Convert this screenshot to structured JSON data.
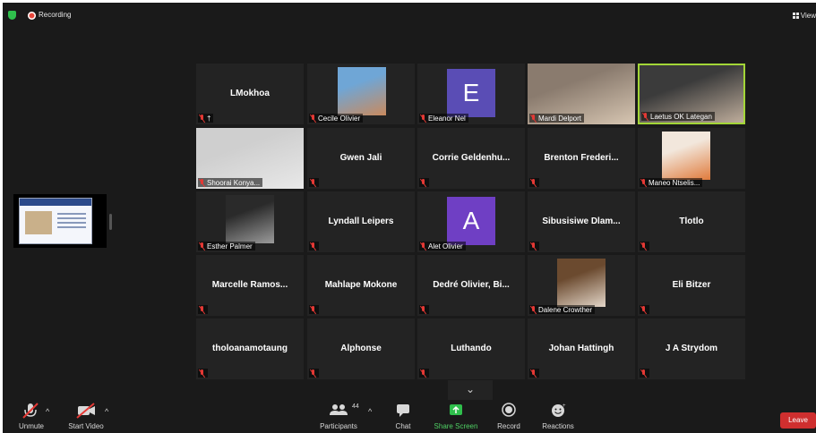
{
  "topbar": {
    "recording_label": "Recording",
    "view_label": "View"
  },
  "participants": [
    {
      "name": "LMokhoa",
      "display": "name",
      "caption": ""
    },
    {
      "name": "Cecile Olivier",
      "display": "photo",
      "caption": "Cecile Olivier"
    },
    {
      "name": "Eleanor Nel",
      "display": "letter",
      "letter": "E",
      "avatar_color": "#5a4db5",
      "caption": "Eleanor Nel"
    },
    {
      "name": "Mardi Delport",
      "display": "photo",
      "caption": "Mardi Delport"
    },
    {
      "name": "Laetus OK Lategan",
      "display": "photo",
      "caption": "Laetus OK Lategan",
      "active": true
    },
    {
      "name": "Shoorai Konya...",
      "display": "photo",
      "caption": "Shoorai Konya..."
    },
    {
      "name": "Gwen Jali",
      "display": "name",
      "caption": ""
    },
    {
      "name": "Corrie  Geldenhu...",
      "display": "name",
      "caption": ""
    },
    {
      "name": "Brenton  Frederi...",
      "display": "name",
      "caption": ""
    },
    {
      "name": "Maneo Ntselis...",
      "display": "photo",
      "caption": "Maneo Ntselis..."
    },
    {
      "name": "Esther Palmer",
      "display": "photo",
      "caption": "Esther Palmer"
    },
    {
      "name": "Lyndall Leipers",
      "display": "name",
      "caption": ""
    },
    {
      "name": "Alet Olivier",
      "display": "letter",
      "letter": "A",
      "avatar_color": "#6f3fc4",
      "caption": "Alet Olivier"
    },
    {
      "name": "Sibusisiwe  Dlam...",
      "display": "name",
      "caption": ""
    },
    {
      "name": "Tlotlo",
      "display": "name",
      "caption": ""
    },
    {
      "name": "Marcelle  Ramos...",
      "display": "name",
      "caption": ""
    },
    {
      "name": "Mahlape Mokone",
      "display": "name",
      "caption": ""
    },
    {
      "name": "Dedré  Olivier,  Bi...",
      "display": "name",
      "caption": ""
    },
    {
      "name": "Dalene Crowther",
      "display": "photo",
      "caption": "Dalene Crowther"
    },
    {
      "name": "Eli Bitzer",
      "display": "name",
      "caption": ""
    },
    {
      "name": "tholoanamotaung",
      "display": "name",
      "caption": ""
    },
    {
      "name": "Alphonse",
      "display": "name",
      "caption": ""
    },
    {
      "name": "Luthando",
      "display": "name",
      "caption": ""
    },
    {
      "name": "Johan Hattingh",
      "display": "name",
      "caption": ""
    },
    {
      "name": "J A Strydom",
      "display": "name",
      "caption": ""
    }
  ],
  "toolbar": {
    "unmute_label": "Unmute",
    "start_video_label": "Start Video",
    "participants_label": "Participants",
    "participants_count": "44",
    "chat_label": "Chat",
    "share_screen_label": "Share Screen",
    "record_label": "Record",
    "reactions_label": "Reactions",
    "leave_label": "Leave"
  },
  "colors": {
    "active_speaker_border": "#a3d637",
    "share_green": "#4fd164",
    "leave_red": "#cf2f2f",
    "recording_red": "#e8473c"
  }
}
